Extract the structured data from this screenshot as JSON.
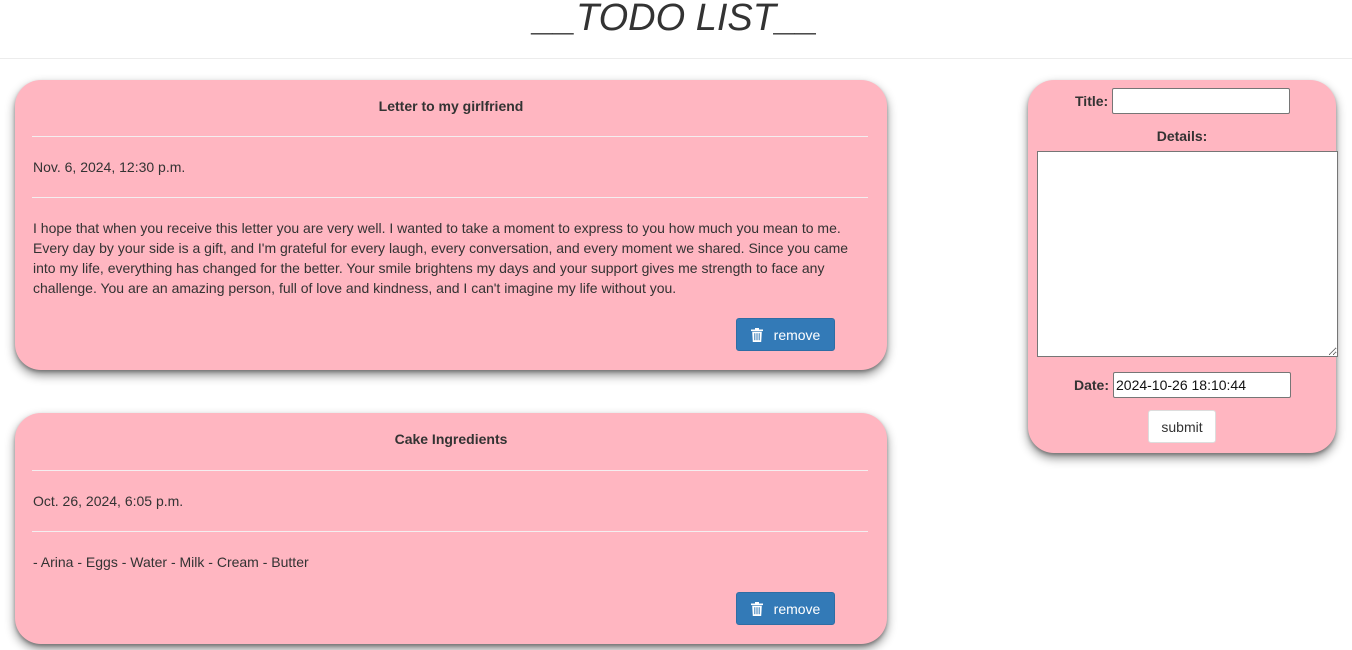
{
  "header": {
    "title": "__TODO LIST__"
  },
  "todos": [
    {
      "title": "Letter to my girlfriend",
      "date": "Nov. 6, 2024, 12:30 p.m.",
      "details": "I hope that when you receive this letter you are very well. I wanted to take a moment to express to you how much you mean to me. Every day by your side is a gift, and I'm grateful for every laugh, every conversation, and every moment we shared. Since you came into my life, everything has changed for the better. Your smile brightens my days and your support gives me strength to face any challenge. You are an amazing person, full of love and kindness, and I can't imagine my life without you.",
      "remove_label": "remove",
      "remove_icon": "trash-icon"
    },
    {
      "title": "Cake Ingredients",
      "date": "Oct. 26, 2024, 6:05 p.m.",
      "details": "- Arina - Eggs - Water - Milk - Cream - Butter",
      "remove_label": "remove",
      "remove_icon": "trash-icon"
    }
  ],
  "form": {
    "title_label": "Title:",
    "title_value": "",
    "details_label": "Details:",
    "details_value": "",
    "date_label": "Date:",
    "date_value": "2024-10-26 18:10:44",
    "submit_label": "submit"
  },
  "colors": {
    "card_background": "#ffb6c1",
    "button_primary": "#337ab7",
    "text": "#333333"
  }
}
